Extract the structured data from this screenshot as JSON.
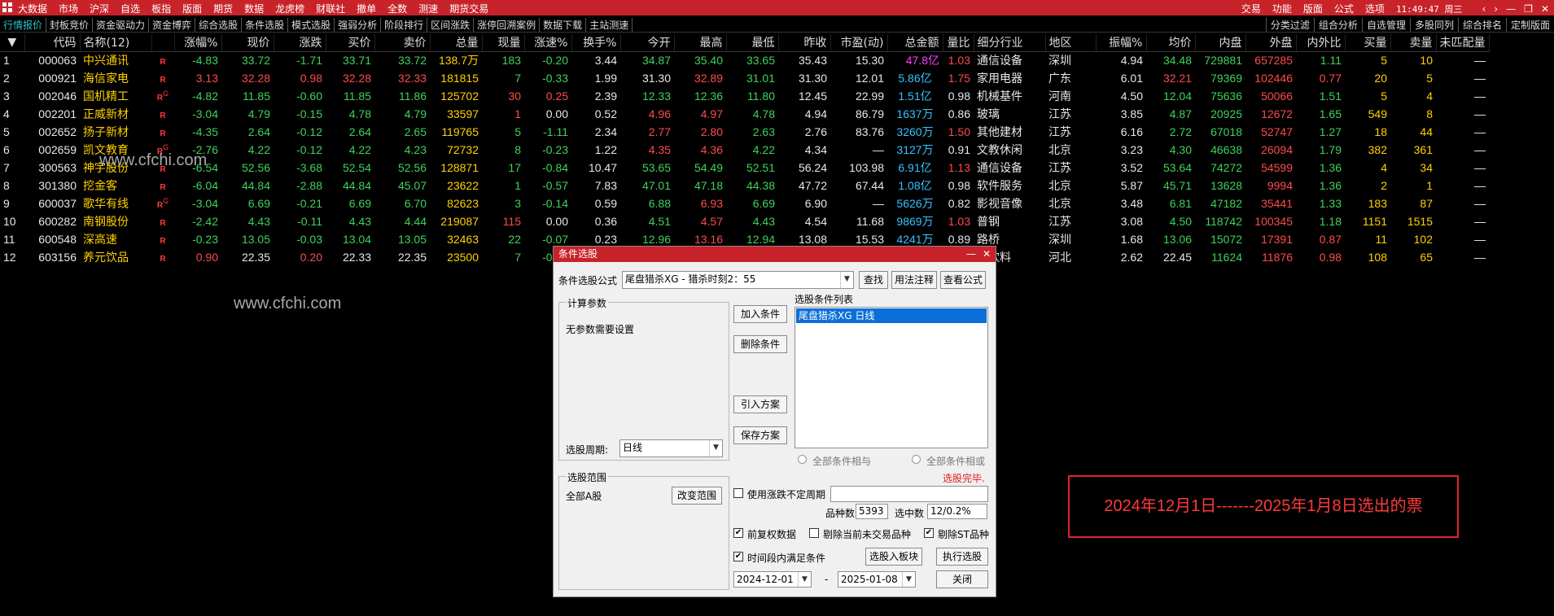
{
  "topbar": {
    "menu": [
      "大数据",
      "市场",
      "沪深",
      "自选",
      "板指",
      "版面",
      "期货",
      "数据",
      "龙虎榜",
      "财联社",
      "撤单",
      "全数",
      "测速",
      "期货交易"
    ],
    "right": [
      "交易",
      "功能",
      "版面",
      "公式",
      "选项"
    ],
    "clock": "11:49:47 周三"
  },
  "tabbar": {
    "tabs": [
      "行情报价",
      "封板竞价",
      "资金驱动力",
      "资金博弈",
      "综合选股",
      "条件选股",
      "模式选股",
      "强弱分析",
      "阶段排行",
      "区间涨跌",
      "涨停回溯案例",
      "数据下载",
      "主站测速"
    ],
    "right_tabs": [
      "分类过滤",
      "组合分析",
      "自选管理",
      "多股同列",
      "综合排名",
      "定制版面"
    ]
  },
  "grid": {
    "headers": [
      "",
      "代码",
      "名称(12)",
      "",
      "涨幅%",
      "现价",
      "涨跌",
      "买价",
      "卖价",
      "总量",
      "现量",
      "涨速%",
      "换手%",
      "今开",
      "最高",
      "最低",
      "昨收",
      "市盈(动)",
      "总金额",
      "量比",
      "细分行业",
      "地区",
      "振幅%",
      "均价",
      "内盘",
      "外盘",
      "内外比",
      "买量",
      "卖量",
      "未匹配量"
    ],
    "rows": [
      [
        "1",
        "000063",
        "中兴通讯",
        "",
        "-4.83",
        "33.72",
        "-1.71",
        "33.71",
        "33.72",
        "138.7万",
        "183",
        "-0.20",
        "3.44",
        "34.87",
        "35.40",
        "33.65",
        "35.43",
        "15.30",
        "47.8亿",
        "1.03",
        "通信设备",
        "深圳",
        "4.94",
        "34.48",
        "729881",
        "657285",
        "1.11",
        "5",
        "10",
        "—"
      ],
      [
        "2",
        "000921",
        "海信家电",
        "",
        "3.13",
        "32.28",
        "0.98",
        "32.28",
        "32.33",
        "181815",
        "7",
        "-0.33",
        "1.99",
        "31.30",
        "32.89",
        "31.01",
        "31.30",
        "12.01",
        "5.86亿",
        "1.75",
        "家用电器",
        "广东",
        "6.01",
        "32.21",
        "79369",
        "102446",
        "0.77",
        "20",
        "5",
        "—"
      ],
      [
        "3",
        "002046",
        "国机精工",
        "G",
        "-4.82",
        "11.85",
        "-0.60",
        "11.85",
        "11.86",
        "125702",
        "30",
        "0.25",
        "2.39",
        "12.33",
        "12.36",
        "11.80",
        "12.45",
        "22.99",
        "1.51亿",
        "0.98",
        "机械基件",
        "河南",
        "4.50",
        "12.04",
        "75636",
        "50066",
        "1.51",
        "5",
        "4",
        "—"
      ],
      [
        "4",
        "002201",
        "正威新材",
        "",
        "-3.04",
        "4.79",
        "-0.15",
        "4.78",
        "4.79",
        "33597",
        "1",
        "0.00",
        "0.52",
        "4.96",
        "4.97",
        "4.78",
        "4.94",
        "86.79",
        "1637万",
        "0.86",
        "玻璃",
        "江苏",
        "3.85",
        "4.87",
        "20925",
        "12672",
        "1.65",
        "549",
        "8",
        "—"
      ],
      [
        "5",
        "002652",
        "扬子新材",
        "",
        "-4.35",
        "2.64",
        "-0.12",
        "2.64",
        "2.65",
        "119765",
        "5",
        "-1.11",
        "2.34",
        "2.77",
        "2.80",
        "2.63",
        "2.76",
        "83.76",
        "3260万",
        "1.50",
        "其他建材",
        "江苏",
        "6.16",
        "2.72",
        "67018",
        "52747",
        "1.27",
        "18",
        "44",
        "—"
      ],
      [
        "6",
        "002659",
        "凯文教育",
        "G",
        "-2.76",
        "4.22",
        "-0.12",
        "4.22",
        "4.23",
        "72732",
        "8",
        "-0.23",
        "1.22",
        "4.35",
        "4.36",
        "4.22",
        "4.34",
        "—",
        "3127万",
        "0.91",
        "文教休闲",
        "北京",
        "3.23",
        "4.30",
        "46638",
        "26094",
        "1.79",
        "382",
        "361",
        "—"
      ],
      [
        "7",
        "300563",
        "神宇股份",
        "",
        "-6.54",
        "52.56",
        "-3.68",
        "52.54",
        "52.56",
        "128871",
        "17",
        "-0.84",
        "10.47",
        "53.65",
        "54.49",
        "52.51",
        "56.24",
        "103.98",
        "6.91亿",
        "1.13",
        "通信设备",
        "江苏",
        "3.52",
        "53.64",
        "74272",
        "54599",
        "1.36",
        "4",
        "34",
        "—"
      ],
      [
        "8",
        "301380",
        "挖金客",
        "",
        "-6.04",
        "44.84",
        "-2.88",
        "44.84",
        "45.07",
        "23622",
        "1",
        "-0.57",
        "7.83",
        "47.01",
        "47.18",
        "44.38",
        "47.72",
        "67.44",
        "1.08亿",
        "0.98",
        "软件服务",
        "北京",
        "5.87",
        "45.71",
        "13628",
        "9994",
        "1.36",
        "2",
        "1",
        "—"
      ],
      [
        "9",
        "600037",
        "歌华有线",
        "G",
        "-3.04",
        "6.69",
        "-0.21",
        "6.69",
        "6.70",
        "82623",
        "3",
        "-0.14",
        "0.59",
        "6.88",
        "6.93",
        "6.69",
        "6.90",
        "—",
        "5626万",
        "0.82",
        "影视音像",
        "北京",
        "3.48",
        "6.81",
        "47182",
        "35441",
        "1.33",
        "183",
        "87",
        "—"
      ],
      [
        "10",
        "600282",
        "南钢股份",
        "",
        "-2.42",
        "4.43",
        "-0.11",
        "4.43",
        "4.44",
        "219087",
        "115",
        "0.00",
        "0.36",
        "4.51",
        "4.57",
        "4.43",
        "4.54",
        "11.68",
        "9869万",
        "1.03",
        "普钢",
        "江苏",
        "3.08",
        "4.50",
        "118742",
        "100345",
        "1.18",
        "1151",
        "1515",
        "—"
      ],
      [
        "11",
        "600548",
        "深高速",
        "",
        "-0.23",
        "13.05",
        "-0.03",
        "13.04",
        "13.05",
        "32463",
        "22",
        "-0.07",
        "0.23",
        "12.96",
        "13.16",
        "12.94",
        "13.08",
        "15.53",
        "4241万",
        "0.89",
        "路桥",
        "深圳",
        "1.68",
        "13.06",
        "15072",
        "17391",
        "0.87",
        "11",
        "102",
        "—"
      ],
      [
        "12",
        "603156",
        "养元饮品",
        "",
        "0.90",
        "22.35",
        "0.20",
        "22.33",
        "22.35",
        "23500",
        "7",
        "-0.01",
        "",
        "",
        "",
        "",
        "",
        "",
        "",
        "",
        "软饮料",
        "河北",
        "2.62",
        "22.45",
        "11624",
        "11876",
        "0.98",
        "108",
        "65",
        "—"
      ]
    ]
  },
  "watermark": "www.cfchi.com",
  "dialog": {
    "title": "条件选股",
    "formula_label": "条件选股公式",
    "formula_value": "尾盘猎杀XG  -  猎杀时刻2：55",
    "btn_find": "查找",
    "btn_usage": "用法注释",
    "btn_view": "查看公式",
    "calc_group": "计算参数",
    "calc_text": "无参数需要设置",
    "period_label": "选股周期:",
    "period_value": "日线",
    "btn_add": "加入条件",
    "btn_delete": "删除条件",
    "btn_import": "引入方案",
    "btn_save": "保存方案",
    "list_label": "选股条件列表",
    "list_item": "尾盘猎杀XG  日线",
    "radio_and": "全部条件相与",
    "radio_or": "全部条件相或",
    "done": "选股完毕.",
    "range_group": "选股范围",
    "range_value": "全部A股",
    "btn_range": "改变范围",
    "chk_uncertain": "使用涨跌不定周期",
    "count_label": "品种数",
    "count_value": "5393",
    "selected_label": "选中数",
    "selected_value": "12/0.2%",
    "chk_fq": "前复权数据",
    "chk_untraded": "剔除当前未交易品种",
    "chk_st": "剔除ST品种",
    "chk_period": "时间段内满足条件",
    "btn_block": "选股入板块",
    "btn_exec": "执行选股",
    "date_from": "2024-12-01",
    "date_sep": "-",
    "date_to": "2025-01-08",
    "btn_close": "关闭"
  },
  "annotation": "2024年12月1日-------2025年1月8日选出的票"
}
